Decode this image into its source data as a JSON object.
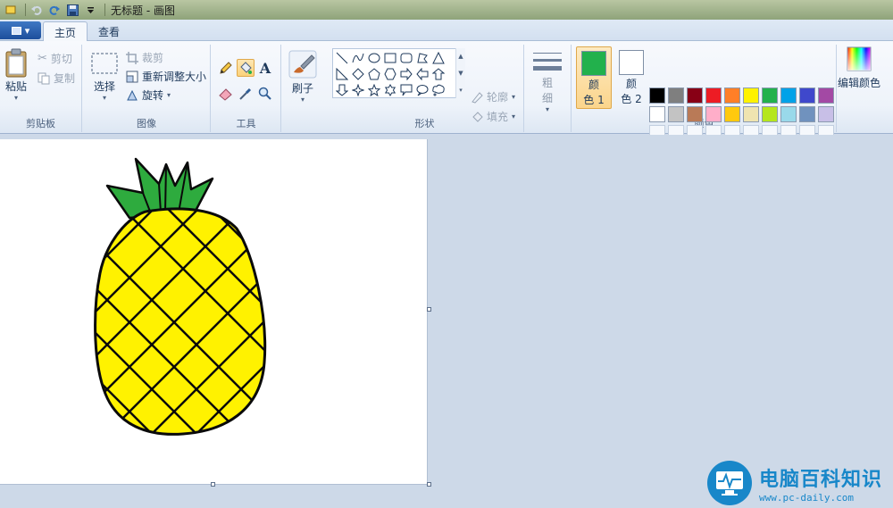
{
  "window": {
    "title": "无标题 - 画图"
  },
  "tabs": {
    "home": "主页",
    "view": "查看"
  },
  "clipboard": {
    "paste": "粘贴",
    "cut": "剪切",
    "copy": "复制",
    "label": "剪贴板"
  },
  "image": {
    "select": "选择",
    "crop": "裁剪",
    "resize": "重新调整大小",
    "rotate": "旋转",
    "label": "图像"
  },
  "tools": {
    "label": "工具"
  },
  "brushes": {
    "label": "刷子"
  },
  "shapes": {
    "outline": "轮廓",
    "fill": "填充",
    "label": "形状"
  },
  "size": {
    "label_line1": "粗",
    "label_line2": "细"
  },
  "colors": {
    "color1_line1": "颜",
    "color1_line2": "色 1",
    "color2_line1": "颜",
    "color2_line2": "色 2",
    "edit": "编辑颜色",
    "label": "颜色",
    "color1_value": "#22b14c",
    "color2_value": "#ffffff",
    "palette_row1": [
      "#000000",
      "#7f7f7f",
      "#880015",
      "#ed1c24",
      "#ff7f27",
      "#fff200",
      "#22b14c",
      "#00a2e8",
      "#3f48cc",
      "#a349a4"
    ],
    "palette_row2": [
      "#ffffff",
      "#c3c3c3",
      "#b97a57",
      "#ffaec9",
      "#ffc90e",
      "#efe4b0",
      "#b5e61d",
      "#99d9ea",
      "#7092be",
      "#c8bfe7"
    ]
  },
  "watermark": {
    "name": "电脑百科知识",
    "url": "www.pc-daily.com"
  },
  "icons": {
    "paste": "clipboard-icon",
    "cut": "scissors-icon",
    "copy": "copy-icon",
    "pencil": "pencil-icon",
    "fill": "bucket-icon",
    "text": "text-icon",
    "eraser": "eraser-icon",
    "picker": "eyedropper-icon",
    "magnifier": "magnifier-icon"
  }
}
